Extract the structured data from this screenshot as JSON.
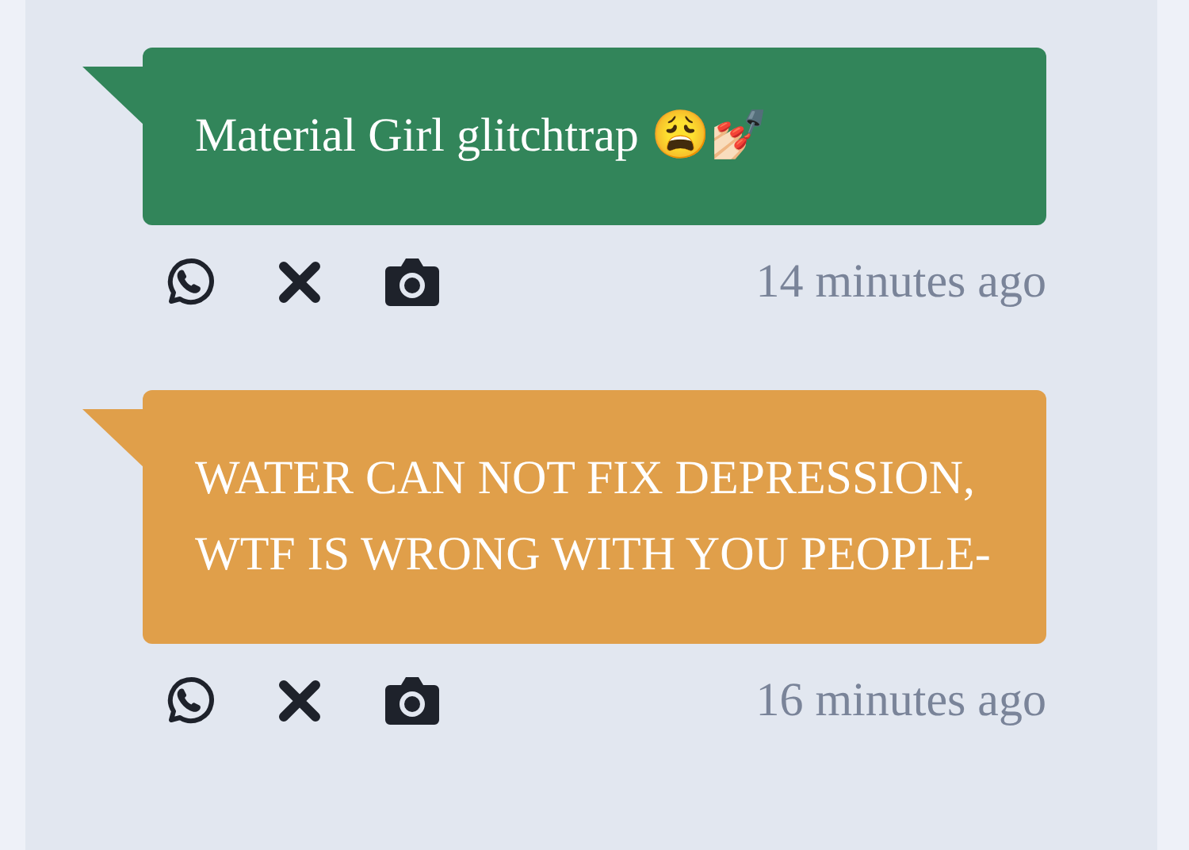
{
  "messages": [
    {
      "text": "Material Girl glitchtrap 😩💅🏻",
      "color": "#32855a",
      "time": "14 minutes ago"
    },
    {
      "text": "WATER CAN NOT FIX DEPRESSION, WTF IS WRONG WITH YOU PEOPLE-",
      "color": "#e09f4a",
      "time": "16 minutes ago"
    }
  ]
}
